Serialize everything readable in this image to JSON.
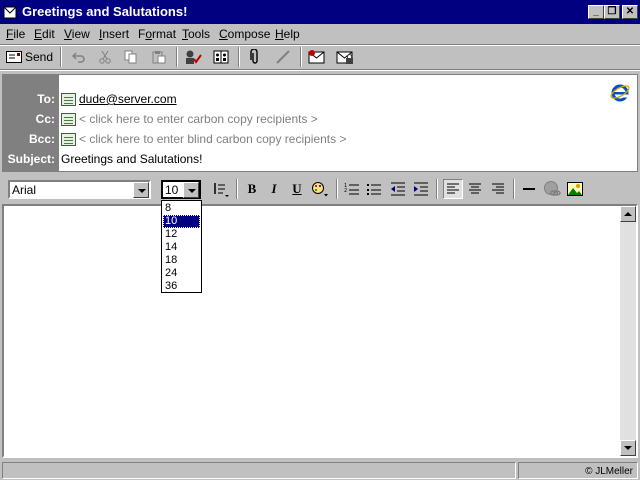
{
  "window": {
    "title": "Greetings and Salutations!"
  },
  "menu": [
    "File",
    "Edit",
    "View",
    "Insert",
    "Format",
    "Tools",
    "Compose",
    "Help"
  ],
  "menu_underline": [
    "F",
    "E",
    "V",
    "I",
    "o",
    "T",
    "C",
    "H"
  ],
  "toolbar": {
    "send_label": "Send"
  },
  "headers": {
    "to_label": "To:",
    "cc_label": "Cc:",
    "bcc_label": "Bcc:",
    "subject_label": "Subject:",
    "to_value": "dude@server.com",
    "cc_hint": "< click here to enter carbon copy recipients >",
    "bcc_hint": "< click here to enter blind carbon copy recipients >",
    "subject_value": "Greetings and Salutations!"
  },
  "format": {
    "font": "Arial",
    "size": "10",
    "bold": "B",
    "italic": "I",
    "underline": "U"
  },
  "size_options": [
    "8",
    "10",
    "12",
    "14",
    "18",
    "24",
    "36"
  ],
  "size_selected_index": 1,
  "status": {
    "credit": "© JLMeller"
  },
  "colors": {
    "titlebar": "#000080",
    "selection": "#000080",
    "face": "#c0c0c0"
  },
  "icons": [
    "mail-window-icon",
    "minimize-icon",
    "restore-icon",
    "close-icon",
    "send-icon",
    "undo-icon",
    "cut-icon",
    "copy-icon",
    "paste-icon",
    "check-names-icon",
    "address-book-icon",
    "attach-icon",
    "signature-icon",
    "sign-message-icon",
    "encrypt-message-icon",
    "ie-logo-icon",
    "style-icon",
    "font-color-icon",
    "numbered-list-icon",
    "bullet-list-icon",
    "decrease-indent-icon",
    "increase-indent-icon",
    "align-left-icon",
    "align-center-icon",
    "align-right-icon",
    "horizontal-line-icon",
    "hyperlink-icon",
    "insert-picture-icon"
  ]
}
